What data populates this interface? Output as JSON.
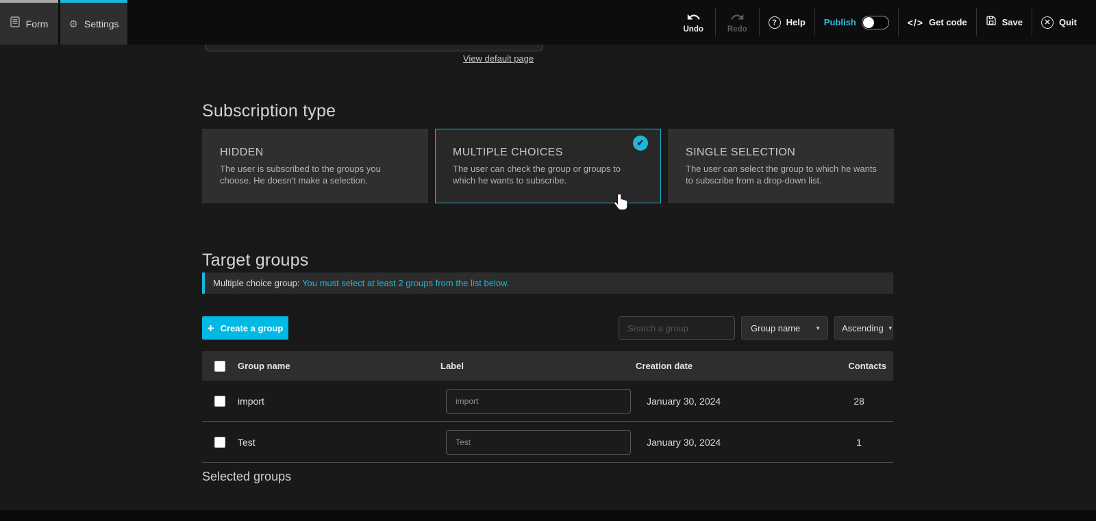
{
  "accent_color": "#1bb8dc",
  "button_color": "#00b9e4",
  "topbar": {
    "tabs": [
      {
        "label": "Form"
      },
      {
        "label": "Settings"
      }
    ],
    "actions": {
      "undo": "Undo",
      "redo": "Redo",
      "help": "Help",
      "publish": "Publish",
      "get_code_glyph": "</>",
      "get_code": "Get code",
      "save": "Save",
      "quit": "Quit"
    }
  },
  "page": {
    "view_default_page_link": "View default page",
    "subscription_type": {
      "title": "Subscription type",
      "options": [
        {
          "title": "HIDDEN",
          "description": "The user is subscribed to the groups you choose. He doesn't make a selection."
        },
        {
          "title": "MULTIPLE CHOICES",
          "description": "The user can check the group or groups to which he wants to subscribe."
        },
        {
          "title": "SINGLE SELECTION",
          "description": "The user can select the group to which he wants to subscribe from a drop-down list."
        }
      ],
      "selected_option": "MULTIPLE CHOICES",
      "check_glyph": "✔"
    },
    "target_groups": {
      "title": "Target groups",
      "notice": {
        "prefix": "Multiple choice group: ",
        "message": "You must select at least 2 groups from the list below."
      },
      "create_button": "Create a group",
      "create_plus_glyph": "+",
      "search_placeholder": "Search a group",
      "sort_field": "Group name",
      "sort_direction": "Ascending",
      "caret_glyph": "▼",
      "table": {
        "headers": {
          "group_name": "Group name",
          "label": "Label",
          "creation_date": "Creation date",
          "contacts": "Contacts"
        },
        "rows": [
          {
            "group_name": "import",
            "label_value": "import",
            "creation_date": "January 30, 2024",
            "contacts": "28"
          },
          {
            "group_name": "Test",
            "label_value": "Test",
            "creation_date": "January 30, 2024",
            "contacts": "1"
          }
        ]
      }
    },
    "selected_groups_title": "Selected groups"
  }
}
